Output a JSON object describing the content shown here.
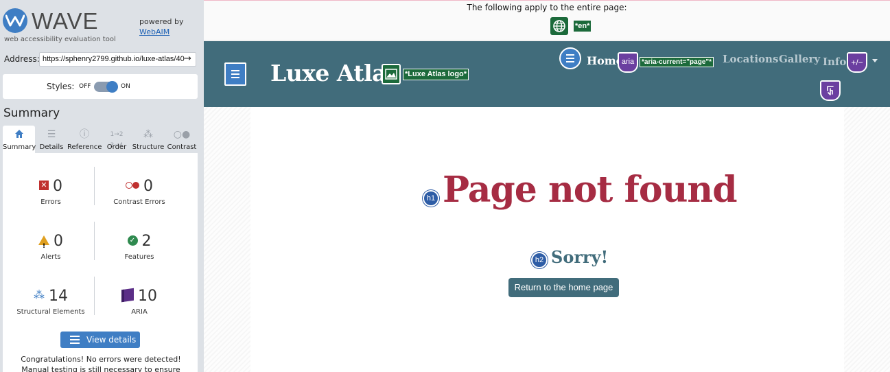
{
  "wave": {
    "brand": "WAVE",
    "tagline": "web accessibility evaluation tool",
    "powered_by": "powered by",
    "powered_link": "WebAIM",
    "address_label": "Address:",
    "address_value": "https://sphenry2799.github.io/luxe-atlas/40",
    "styles_label": "Styles:",
    "styles_off": "OFF",
    "styles_on": "ON",
    "summary_title": "Summary",
    "tabs": [
      {
        "label": "Summary",
        "icon": "home-icon",
        "active": true
      },
      {
        "label": "Details",
        "icon": "list-icon",
        "active": false
      },
      {
        "label": "Reference",
        "icon": "info-icon",
        "active": false
      },
      {
        "label": "Order",
        "icon": "order-icon",
        "active": false
      },
      {
        "label": "Structure",
        "icon": "structure-icon",
        "active": false
      },
      {
        "label": "Contrast",
        "icon": "contrast-icon",
        "active": false
      }
    ],
    "stats": {
      "errors": {
        "value": "0",
        "label": "Errors"
      },
      "contrast": {
        "value": "0",
        "label": "Contrast Errors"
      },
      "alerts": {
        "value": "0",
        "label": "Alerts"
      },
      "features": {
        "value": "2",
        "label": "Features"
      },
      "structure": {
        "value": "14",
        "label": "Structural Elements"
      },
      "aria": {
        "value": "10",
        "label": "ARIA"
      }
    },
    "view_details": "View details ›",
    "congrats": "Congratulations! No errors were detected! Manual testing is still necessary to ensure compliance and"
  },
  "page": {
    "banner_text": "The following apply to the entire page:",
    "lang_tag": "*en*",
    "site_title": "Luxe Atlas",
    "logo_alt_tag": "*Luxe Atlas logo*",
    "nav": {
      "home": "Home",
      "aria_label": "aria",
      "aria_current_tag": "*aria-current=\"page\"*",
      "locations": "Locations",
      "gallery": "Gallery",
      "info": "Info",
      "expand_label": "+/−"
    },
    "h1_badge": "h1",
    "h1": "Page not found",
    "h2_badge": "h2",
    "h2": "Sorry!",
    "home_button": "Return to the home page"
  },
  "colors": {
    "wave_blue": "#3f7ec4",
    "header_teal": "#416c7b",
    "heading_red": "#a62c43",
    "feature_green": "#1c6a3b",
    "aria_purple": "#6b3fa0"
  }
}
